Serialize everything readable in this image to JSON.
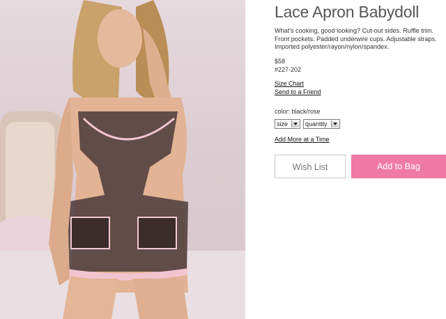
{
  "product": {
    "title": "Lace Apron Babydoll",
    "description": "What's cooking, good looking? Cut-out sides. Ruffle trim. Front pockets. Padded underwire cups. Adjustable straps. Imported polyester/rayon/nylon/spandex.",
    "price": "$58",
    "sku": "#227-202",
    "color_text": "color: black/rose"
  },
  "links": {
    "size_chart": "Size Chart",
    "send_friend": "Send to a Friend",
    "add_more": "Add More at a Time"
  },
  "selects": {
    "size": "size",
    "quantity": "quantity"
  },
  "buttons": {
    "wish_list": "Wish List",
    "add_to_bag": "Add to Bag"
  },
  "colors": {
    "add_to_bag_bg": "#ef7aa5",
    "title_text": "#555555"
  },
  "icons": {
    "dropdown": "chevron-down-icon"
  }
}
